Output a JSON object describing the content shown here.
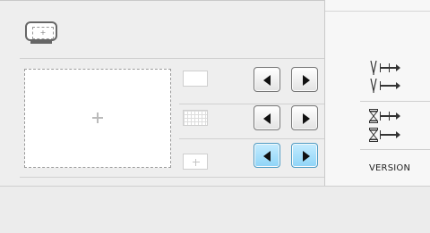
{
  "labels": {
    "version": "VERSION"
  },
  "frame_button": {
    "icon": "embroidery-frame-icon",
    "glyph": "+"
  },
  "rows": [
    {
      "thumb_style": "plain",
      "left_icon": "left-arrow-icon",
      "right_icon": "right-arrow-icon",
      "active": false
    },
    {
      "thumb_style": "grid",
      "left_icon": "left-arrow-icon",
      "right_icon": "right-arrow-icon",
      "active": false
    },
    {
      "thumb_style": "cross",
      "left_icon": "left-arrow-icon",
      "right_icon": "right-arrow-icon",
      "active": true
    }
  ],
  "side_icons": [
    "needle-width-icon",
    "needle-length-icon",
    "hourglass-width-icon",
    "hourglass-length-icon"
  ],
  "colors": {
    "active_button": "#8fd4f7",
    "active_border": "#4d9bc4",
    "panel_bg": "#eeeeee"
  }
}
